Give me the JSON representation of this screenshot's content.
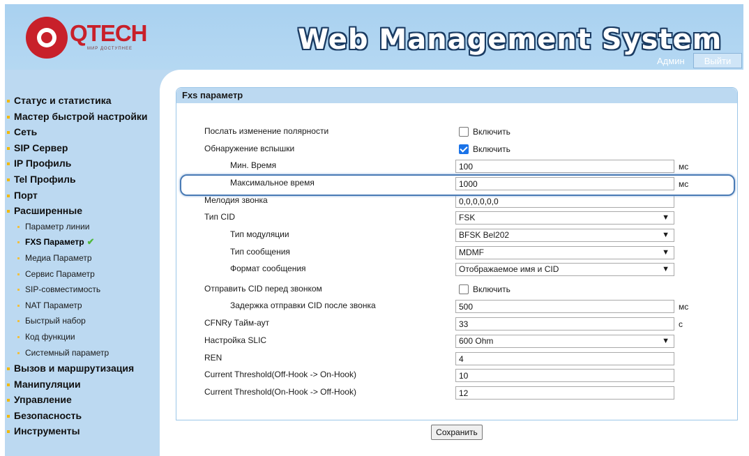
{
  "header": {
    "logo_text": "QTECH",
    "logo_sub": "МИР ДОСТУПНЕЕ",
    "title": "Web Management System",
    "user_label": "Админ",
    "logout_label": "Выйти"
  },
  "sidebar": {
    "items": [
      {
        "label": "Статус и статистика"
      },
      {
        "label": "Мастер быстрой настройки"
      },
      {
        "label": "Сеть"
      },
      {
        "label": "SIP Сервер"
      },
      {
        "label": "IP Профиль"
      },
      {
        "label": "Tel Профиль"
      },
      {
        "label": "Порт"
      },
      {
        "label": "Расширенные"
      },
      {
        "label": "Параметр линии"
      },
      {
        "label": "FXS Параметр"
      },
      {
        "label": "Медиа Параметр"
      },
      {
        "label": "Сервис Параметр"
      },
      {
        "label": "SIP-совместимость"
      },
      {
        "label": "NAT Параметр"
      },
      {
        "label": "Быстрый набор"
      },
      {
        "label": "Код функции"
      },
      {
        "label": "Системный параметр"
      },
      {
        "label": "Вызов и маршрутизация"
      },
      {
        "label": "Манипуляции"
      },
      {
        "label": "Управление"
      },
      {
        "label": "Безопасность"
      },
      {
        "label": "Инструменты"
      }
    ]
  },
  "panel": {
    "title": "Fxs параметр",
    "rows": [
      {
        "label": "Послать изменение полярности",
        "checkbox_label": "Включить",
        "checked": false
      },
      {
        "label": "Обнаружение вспышки",
        "checkbox_label": "Включить",
        "checked": true
      },
      {
        "label": "Мин. Время",
        "value": "100",
        "unit": "мс"
      },
      {
        "label": "Максимальное время",
        "value": "1000",
        "unit": "мс"
      },
      {
        "label": "Мелодия звонка",
        "value": "0,0,0,0,0,0"
      },
      {
        "label": "Тип CID",
        "value": "FSK"
      },
      {
        "label": "Тип модуляции",
        "value": "BFSK Bel202"
      },
      {
        "label": "Тип сообщения",
        "value": "MDMF"
      },
      {
        "label": "Формат сообщения",
        "value": "Отображаемое имя и CID"
      },
      {
        "label": "Отправить CID перед звонком",
        "checkbox_label": "Включить",
        "checked": false
      },
      {
        "label": "Задержка отправки CID после звонка",
        "value": "500",
        "unit": "мс"
      },
      {
        "label": "CFNRy Тайм-аут",
        "value": "33",
        "unit": "с"
      },
      {
        "label": "Настройка SLIC",
        "value": "600 Ohm"
      },
      {
        "label": "REN",
        "value": "4"
      },
      {
        "label": "Current Threshold(Off-Hook -> On-Hook)",
        "value": "10"
      },
      {
        "label": "Current Threshold(On-Hook -> Off-Hook)",
        "value": "12"
      }
    ]
  },
  "save_label": "Сохранить",
  "icons": {
    "active_mark": "check-icon",
    "dropdown": "chevron-down-icon"
  }
}
